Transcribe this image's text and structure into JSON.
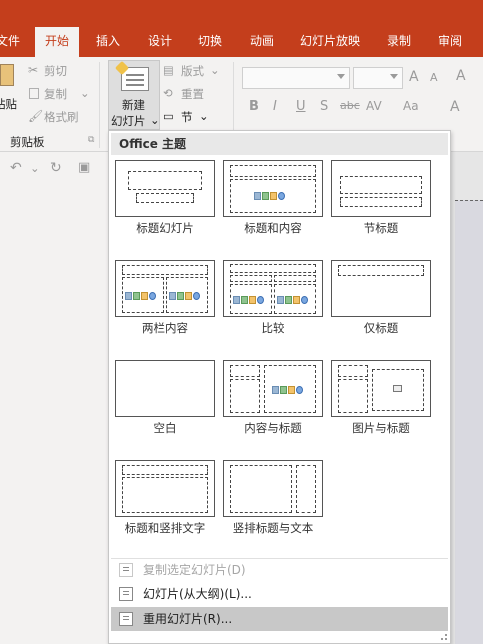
{
  "tabs": [
    {
      "label": "文件"
    },
    {
      "label": "开始",
      "active": true
    },
    {
      "label": "插入"
    },
    {
      "label": "设计"
    },
    {
      "label": "切换"
    },
    {
      "label": "动画"
    },
    {
      "label": "幻灯片放映"
    },
    {
      "label": "录制"
    },
    {
      "label": "审阅"
    }
  ],
  "ribbon": {
    "paste_label": "粘贴",
    "cut_label": "剪切",
    "copy_label": "复制",
    "format_painter_label": "格式刷",
    "clipboard_group": "剪贴板",
    "new_slide_line1": "新建",
    "new_slide_line2": "幻灯片",
    "layout_label": "版式",
    "reset_label": "重置",
    "section_label": "节",
    "font_grow": "A",
    "font_shrink": "A",
    "bold": "B",
    "italic": "I",
    "underline": "U",
    "shadow": "S",
    "strike": "abc",
    "spacing": "AV",
    "change_case": "Aa",
    "font_color": "A"
  },
  "dropdown": {
    "header": "Office 主题",
    "layouts": [
      {
        "name": "标题幻灯片"
      },
      {
        "name": "标题和内容"
      },
      {
        "name": "节标题"
      },
      {
        "name": "两栏内容"
      },
      {
        "name": "比较"
      },
      {
        "name": "仅标题"
      },
      {
        "name": "空白"
      },
      {
        "name": "内容与标题"
      },
      {
        "name": "图片与标题"
      },
      {
        "name": "标题和竖排文字"
      },
      {
        "name": "竖排标题与文本"
      }
    ],
    "menu": [
      {
        "label": "复制选定幻灯片(D)",
        "disabled": true
      },
      {
        "label": "幻灯片(从大纲)(L)...",
        "disabled": false
      },
      {
        "label": "重用幻灯片(R)...",
        "disabled": false
      }
    ]
  },
  "colors": {
    "accent": "#c43e1c",
    "ribbon_bg": "#f3f2f1",
    "hover": "#c8c8c8"
  }
}
